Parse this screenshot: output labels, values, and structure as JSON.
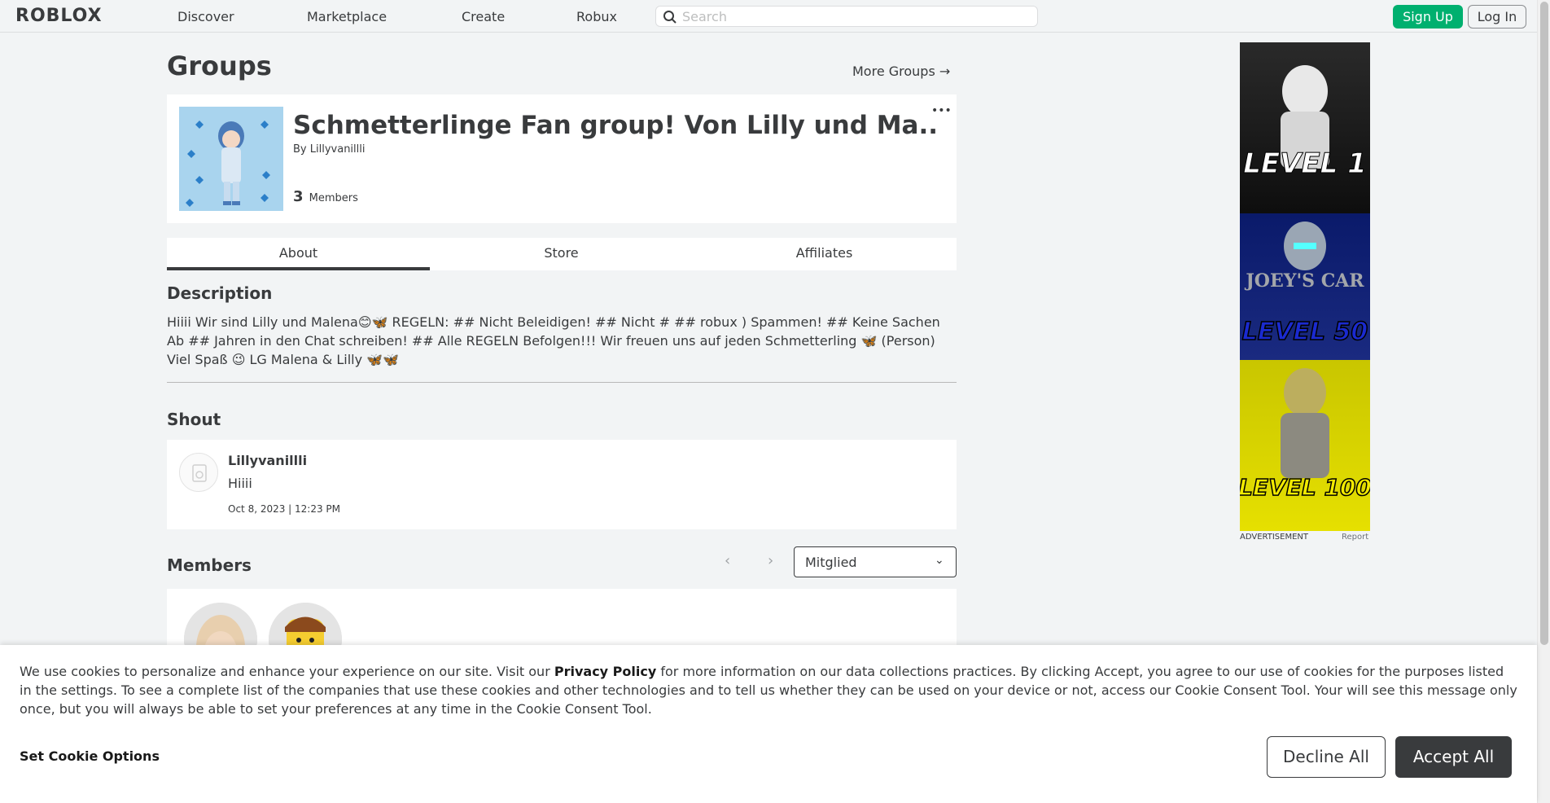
{
  "header": {
    "logo": "ROBLOX",
    "nav": [
      "Discover",
      "Marketplace",
      "Create",
      "Robux"
    ],
    "search_placeholder": "Search",
    "signup_label": "Sign Up",
    "login_label": "Log In"
  },
  "page": {
    "title": "Groups",
    "more_groups": "More Groups →"
  },
  "group": {
    "name": "Schmetterlinge Fan group! Von Lilly und Ma...",
    "by_label": "By",
    "owner": "Lillyvanillli",
    "member_count": "3",
    "members_label": "Members",
    "more_menu": "•••"
  },
  "tabs": [
    "About",
    "Store",
    "Affiliates"
  ],
  "about": {
    "description_heading": "Description",
    "description": "Hiiii Wir sind Lilly und Malena😊🦋 REGELN: ## Nicht Beleidigen! ## Nicht # ## robux ) Spammen! ## Keine Sachen Ab ## Jahren in den Chat schreiben! ## Alle REGELN Befolgen!!! Wir freuen uns auf jeden Schmetterling 🦋 (Person) Viel Spaß 😉 LG Malena & Lilly 🦋🦋",
    "shout_heading": "Shout",
    "shout": {
      "author": "Lillyvanillli",
      "body": "Hiiii",
      "date": "Oct 8, 2023 | 12:23 PM"
    },
    "members_heading": "Members",
    "role_selected": "Mitglied"
  },
  "ad": {
    "texts": [
      "LEVEL 1",
      "JOEY'S CAR",
      "LEVEL 50",
      "LEVEL 100"
    ],
    "label": "ADVERTISEMENT",
    "report": "Report"
  },
  "cookie": {
    "text_before": "We use cookies to personalize and enhance your experience on our site. Visit our ",
    "link": "Privacy Policy",
    "text_after": " for more information on our data collections practices. By clicking Accept, you agree to our use of cookies for the purposes listed in the settings. To see a complete list of the companies that use these cookies and other technologies and to tell us whether they can be used on your device or not, access our Cookie Consent Tool. Your will see this message only once, but you will always be able to set your preferences at any time in the Cookie Consent Tool.",
    "options": "Set Cookie Options",
    "decline": "Decline All",
    "accept": "Accept All"
  },
  "colors": {
    "signup_green": "#00b06f",
    "text_dark": "#393b3d",
    "page_bg": "#f2f4f5"
  }
}
